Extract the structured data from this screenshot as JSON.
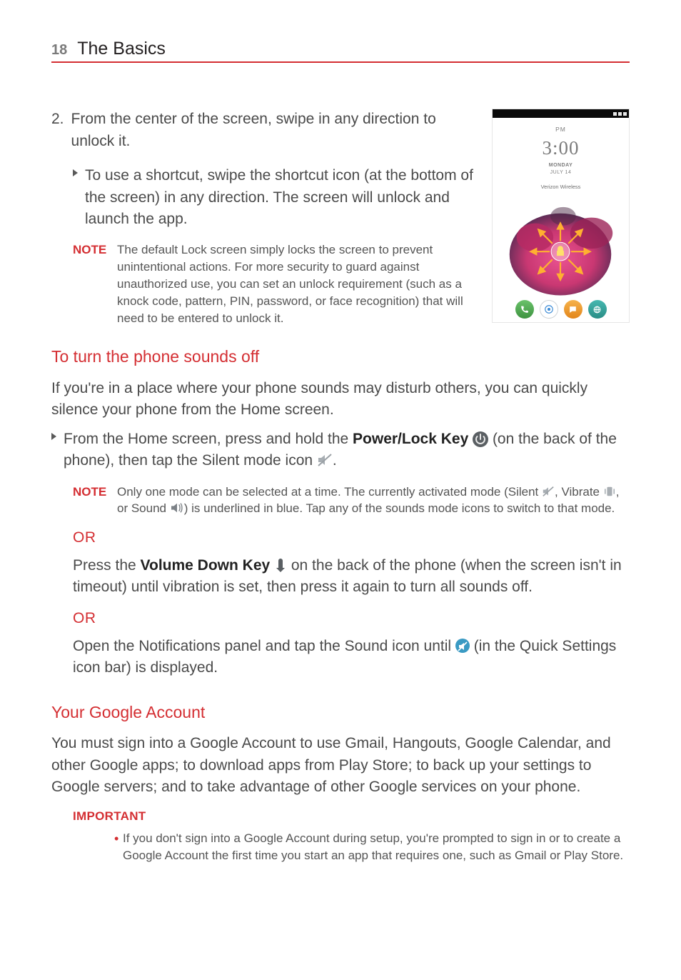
{
  "header": {
    "page_number": "18",
    "section": "The Basics"
  },
  "step2": {
    "number": "2.",
    "text": "From the center of the screen, swipe in any direction to unlock it.",
    "sub_bullet": "To use a shortcut, swipe the shortcut icon (at the bottom of the screen) in any direction. The screen will unlock and launch the app.",
    "note_label": "NOTE",
    "note_body": "The default Lock screen simply locks the screen to prevent unintentional actions. For more security to guard against unauthorized use, you can set an unlock requirement (such as a knock code, pattern, PIN, password, or face recognition) that will need to be entered to unlock it."
  },
  "sounds": {
    "heading": "To turn the phone sounds off",
    "intro": "If you're in a place where your phone sounds may disturb others, you can quickly silence your phone from the Home screen.",
    "bullet_pre": "From the Home screen, press and hold the ",
    "power_key": "Power/Lock Key",
    "bullet_post1": " (on the back of the phone), then tap the Silent mode icon ",
    "bullet_post2": ".",
    "note_label": "NOTE",
    "note_pre": "Only one mode can be selected at a time. The currently activated mode (Silent ",
    "note_mid1": ", Vibrate ",
    "note_mid2": ", or Sound ",
    "note_post": ") is underlined in blue. Tap any of the sounds mode icons to switch to that mode.",
    "or": "OR",
    "alt1_pre": "Press the ",
    "vol_key": "Volume Down Key",
    "alt1_post": " on the back of the phone (when the screen isn't in timeout) until vibration is set, then press it again to turn all sounds off.",
    "alt2_pre": "Open the Notifications panel and tap the Sound icon until ",
    "alt2_post": " (in the Quick Settings icon bar) is displayed."
  },
  "google": {
    "heading": "Your Google Account",
    "body": "You must sign into a Google Account to use Gmail, Hangouts, Google Calendar, and other Google apps; to download apps from Play Store; to back up your settings to Google servers; and to take advantage of other Google services on your phone.",
    "important_label": "IMPORTANT",
    "important_body": "If you don't sign into a Google Account during setup, you're prompted to sign in or to create a Google Account the first time you start an app that requires one, such as Gmail or Play Store."
  },
  "phone": {
    "pm": "PM",
    "time": "3:00",
    "day": "MONDAY",
    "date": "JULY 14",
    "carrier": "Verizon Wireless"
  },
  "icons": {
    "power": "power-lock-key-icon",
    "silent": "silent-mode-icon",
    "vibrate": "vibrate-mode-icon",
    "sound": "sound-mode-icon",
    "voldown": "volume-down-key-icon",
    "qs_silent": "quicksettings-silent-icon"
  }
}
